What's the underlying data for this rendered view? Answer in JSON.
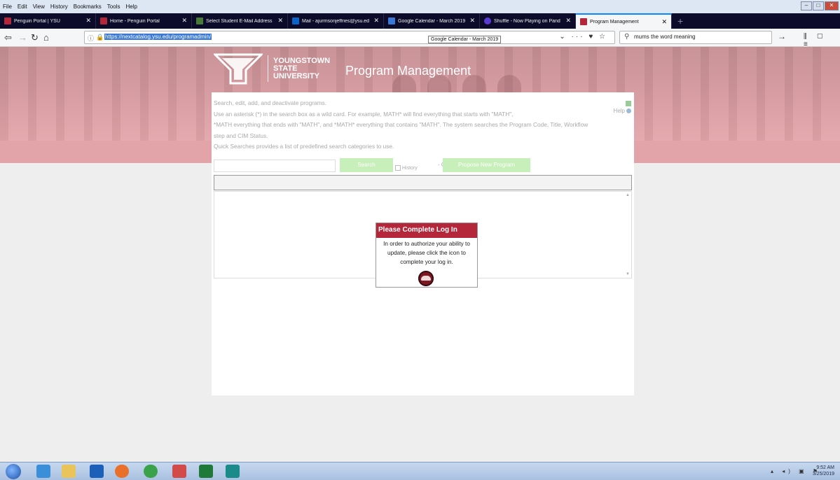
{
  "menubar": {
    "items": [
      "File",
      "Edit",
      "View",
      "History",
      "Bookmarks",
      "Tools",
      "Help"
    ]
  },
  "tabs": [
    {
      "label": "Penguin Portal | YSU",
      "icon_color": "#b4263a"
    },
    {
      "label": "Home - Penguin Portal",
      "icon_color": "#b4263a"
    },
    {
      "label": "Select Student E-Mail Address",
      "icon_color": "#4a7a3a"
    },
    {
      "label": "Mail - ajurmsonjeffries@ysu.ed",
      "icon_color": "#0a64c8"
    },
    {
      "label": "Google Calendar - March 2019",
      "icon_color": "#3a78d5"
    },
    {
      "label": "Shuffle - Now Playing on Pand",
      "icon_color": "#5a3ad5"
    },
    {
      "label": "Program Management",
      "icon_color": "#b4263a"
    }
  ],
  "navbar": {
    "url": "https://nextcatalog.ysu.edu/programadmin/",
    "tooltip": "Google Calendar - March 2019",
    "search_value": "mums the word meaning"
  },
  "header": {
    "logo_line1": "YOUNGSTOWN",
    "logo_line2": "STATE",
    "logo_line3": "UNIVERSITY",
    "title": "Program Management"
  },
  "main": {
    "desc_line1": "Search, edit, add, and deactivate programs.",
    "desc_line2": "Use an asterisk (*) in the search box as a wild card. For example, MATH* will find everything that starts with \"MATH\",",
    "desc_line3": "*MATH everything that ends with \"MATH\", and *MATH* everything that contains \"MATH\". The system searches the Program Code, Title, Workflow",
    "desc_line4": "step and CIM Status.",
    "desc_line5": "Quick Searches provides a list of predefined search categories to use.",
    "help_label": "Help",
    "search_button": "Search",
    "history_label": "History",
    "or_label": "- OR -",
    "propose_button": "Propose New Program"
  },
  "login_dialog": {
    "title": "Please Complete Log In",
    "line1": "In order to authorize your ability to",
    "line2": "update, please click the icon to",
    "line3": "complete your log in."
  },
  "taskbar": {
    "time": "9:52 AM",
    "date": "3/25/2019",
    "apps": [
      {
        "name": "ie",
        "color": "#3a8fd8"
      },
      {
        "name": "explorer",
        "color": "#e9c45a"
      },
      {
        "name": "outlook",
        "color": "#1c5fb8"
      },
      {
        "name": "firefox",
        "color": "#e8702a"
      },
      {
        "name": "chrome",
        "color": "#3aa34a"
      },
      {
        "name": "snipping",
        "color": "#d34a4a"
      },
      {
        "name": "excel",
        "color": "#1f7a3a"
      },
      {
        "name": "publisher",
        "color": "#1a8a8a"
      }
    ]
  }
}
